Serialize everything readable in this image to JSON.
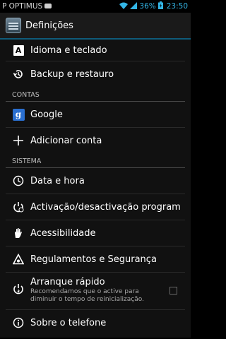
{
  "status_bar": {
    "carrier": "P OPTIMUS",
    "battery": "36%",
    "time": "23:50"
  },
  "action_bar": {
    "title": "Definições",
    "icon": "settings-app-icon"
  },
  "list": {
    "language": {
      "label": "Idioma e teclado",
      "icon": "language-icon"
    },
    "backup": {
      "label": "Backup e restauro",
      "icon": "backup-restore-icon"
    },
    "accounts_header": "CONTAS",
    "google": {
      "label": "Google",
      "icon": "google-icon",
      "glyph": "g"
    },
    "add_account": {
      "label": "Adicionar conta",
      "icon": "plus-icon"
    },
    "system_header": "SISTEMA",
    "date_time": {
      "label": "Data e hora",
      "icon": "clock-icon"
    },
    "power_schedule": {
      "label": "Activação/desactivação program",
      "icon": "power-clock-icon"
    },
    "accessibility": {
      "label": "Acessibilidade",
      "icon": "hand-icon"
    },
    "regulatory": {
      "label": "Regulamentos e Segurança",
      "icon": "warning-icon"
    },
    "quick_start": {
      "label": "Arranque rápido",
      "summary_line1": "Recomendamos que o active para",
      "summary_line2": "diminuir o tempo de reinicialização.",
      "checked": false,
      "icon": "quick-power-icon"
    },
    "about": {
      "label": "Sobre o telefone",
      "icon": "info-icon"
    }
  },
  "colors": {
    "accent": "#33b5e5",
    "background": "#111111"
  }
}
